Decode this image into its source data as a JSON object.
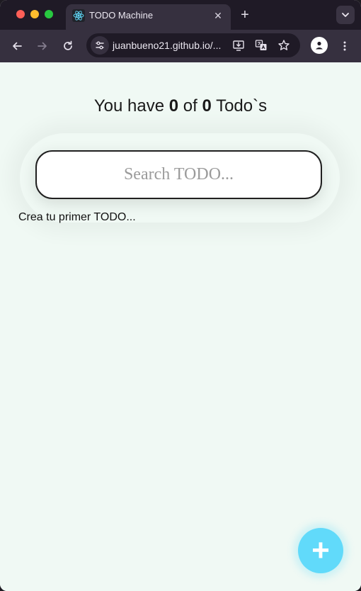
{
  "browser": {
    "tab_title": "TODO Machine",
    "tab_close_glyph": "✕",
    "new_tab_glyph": "+",
    "url": "juanbueno21.github.io/...",
    "icons": [
      "back-icon",
      "forward-icon",
      "reload-icon",
      "site-info-icon",
      "install-app-icon",
      "translate-icon",
      "bookmark-star-icon",
      "profile-icon",
      "menu-icon",
      "tab-search-icon",
      "react-favicon"
    ]
  },
  "counter": {
    "prefix": "You have ",
    "completed": "0",
    "middle": " of ",
    "total": "0",
    "suffix": " Todo`s"
  },
  "search": {
    "placeholder": "Search TODO...",
    "value": ""
  },
  "empty_message": "Crea tu primer TODO...",
  "fab": {
    "label": "+"
  },
  "colors": {
    "page_bg": "#f0f9f4",
    "fab": "#61dafa",
    "tab_strip": "#1f1a26",
    "toolbar": "#36303f"
  }
}
